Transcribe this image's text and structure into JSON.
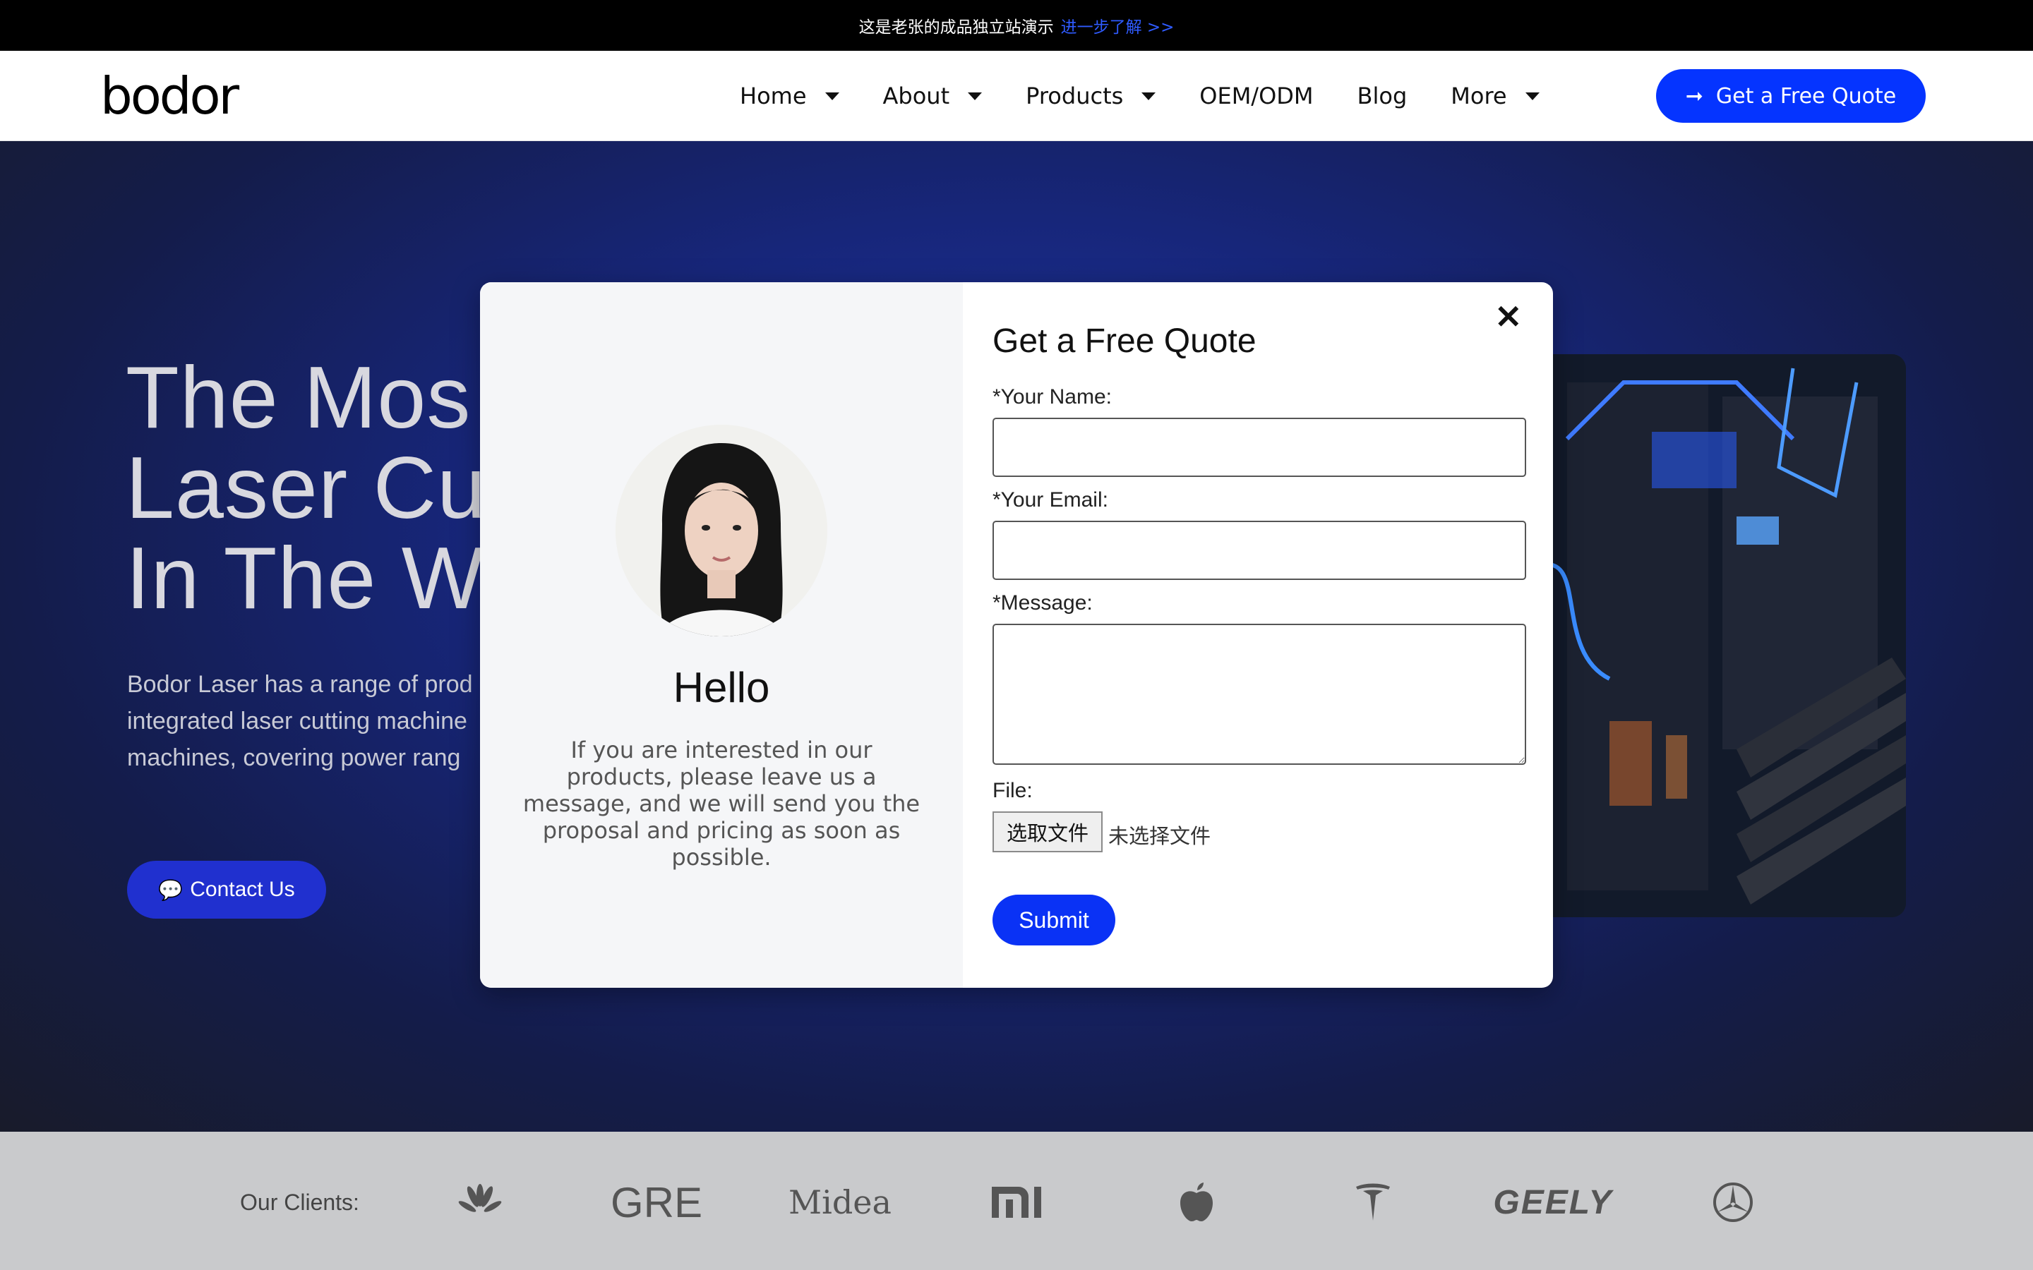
{
  "topbar": {
    "text": "这是老张的成品独立站演示",
    "link": "进一步了解 >>"
  },
  "header": {
    "logo": "bodor",
    "nav": [
      {
        "label": "Home",
        "dropdown": true
      },
      {
        "label": "About",
        "dropdown": true
      },
      {
        "label": "Products",
        "dropdown": true
      },
      {
        "label": "OEM/ODM",
        "dropdown": false
      },
      {
        "label": "Blog",
        "dropdown": false
      },
      {
        "label": "More",
        "dropdown": true
      }
    ],
    "cta": "Get a Free Quote"
  },
  "hero": {
    "title_lines": [
      "The Mos",
      "Laser Cu",
      "In The W"
    ],
    "desc_lines": [
      "Bodor Laser has a range of prod",
      "integrated laser cutting machine",
      "machines, covering power rang"
    ],
    "contact_label": "Contact Us"
  },
  "clients": {
    "label": "Our Clients:",
    "logos": [
      "huawei-logo",
      "GRE",
      "Midea",
      "mi-logo",
      "apple-logo",
      "tesla-logo",
      "GEELY",
      "mercedes-logo"
    ]
  },
  "modal": {
    "hello": "Hello",
    "hello_text": "If you are interested in our products, please leave us a message, and we will send you the proposal and pricing as soon as possible.",
    "title": "Get a Free Quote",
    "name_label": "*Your Name:",
    "email_label": "*Your Email:",
    "message_label": "*Message:",
    "file_label": "File:",
    "file_button": "选取文件",
    "file_status": "未选择文件",
    "submit": "Submit",
    "close": "✕"
  },
  "colors": {
    "accent": "#0534ff",
    "topbar_bg": "#000000",
    "hero_bg": "#17267a"
  }
}
